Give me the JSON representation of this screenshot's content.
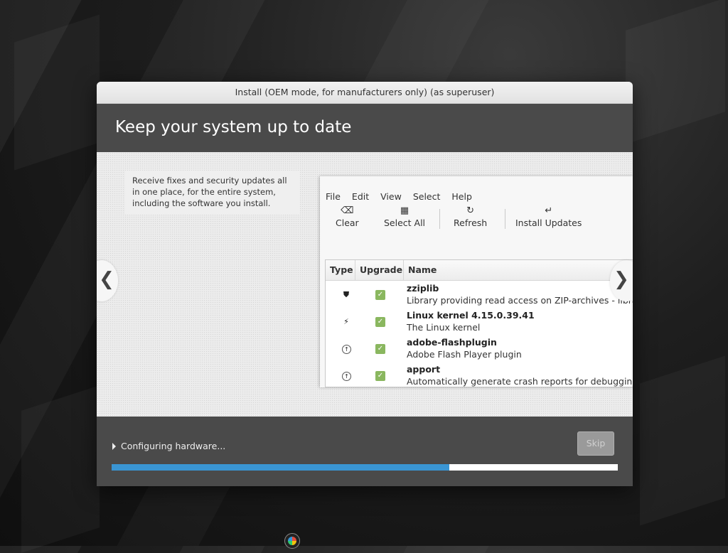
{
  "window": {
    "title": "Install (OEM mode, for manufacturers only) (as superuser)"
  },
  "header": {
    "title": "Keep your system up to date"
  },
  "slide": {
    "text": "Receive fixes and security updates all in one place, for the entire system, including the software you install.",
    "prev_label": "❮",
    "next_label": "❯"
  },
  "mock_app": {
    "menu": [
      "File",
      "Edit",
      "View",
      "Select",
      "Help"
    ],
    "toolbar": [
      {
        "label": "Clear",
        "icon": "clear-icon"
      },
      {
        "label": "Select All",
        "icon": "select-all-icon"
      },
      {
        "label": "Refresh",
        "icon": "refresh-icon"
      },
      {
        "label": "Install Updates",
        "icon": "install-icon"
      }
    ],
    "columns": [
      "Type",
      "Upgrade",
      "Name"
    ],
    "packages": [
      {
        "type_icon": "shield-icon",
        "name": "zziplib",
        "description": "Library providing read access on ZIP-archives - library"
      },
      {
        "type_icon": "kernel-bolt-icon",
        "name": "Linux kernel 4.15.0.39.41",
        "description": "The Linux kernel"
      },
      {
        "type_icon": "upgrade-arrow-icon",
        "name": "adobe-flashplugin",
        "description": "Adobe Flash Player plugin"
      },
      {
        "type_icon": "upgrade-arrow-icon",
        "name": "apport",
        "description": "Automatically generate crash reports for debugging"
      }
    ]
  },
  "footer": {
    "status": "Configuring hardware...",
    "skip_label": "Skip",
    "progress_fraction": 0.667
  },
  "colors": {
    "accent": "#3a95d3",
    "header_bg": "#4a4a4a",
    "check_green": "#8ab75f"
  }
}
